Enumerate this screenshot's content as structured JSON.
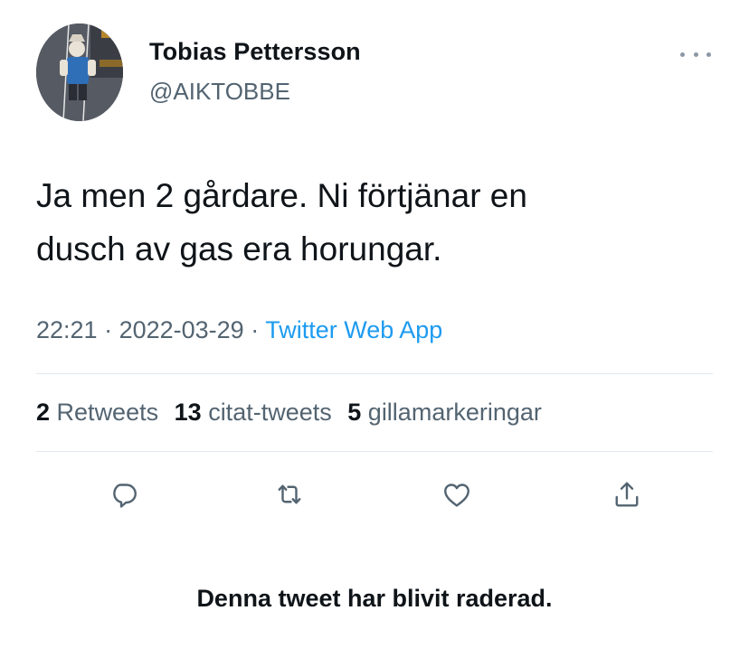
{
  "author": {
    "name": "Tobias Pettersson",
    "handle": "@AIKTOBBE",
    "avatar_icon": "avatar-figure-icon"
  },
  "tweet": {
    "line1": "Ja men 2 gårdare. Ni förtjänar en",
    "line2": "dusch av gas era horungar."
  },
  "meta": {
    "time": "22:21",
    "separator": " · ",
    "date": "2022-03-29",
    "app": "Twitter Web App"
  },
  "stats": {
    "retweets_count": "2",
    "retweets_label": "Retweets",
    "quotes_count": "13",
    "quotes_label": "citat-tweets",
    "likes_count": "5",
    "likes_label": "gillamarkeringar"
  },
  "actions": {
    "reply_icon": "reply-icon",
    "retweet_icon": "retweet-icon",
    "like_icon": "heart-icon",
    "share_icon": "share-icon"
  },
  "notice": "Denna tweet har blivit raderad.",
  "colors": {
    "link": "#1d9bf0",
    "muted": "#536471",
    "text": "#0f1419"
  }
}
